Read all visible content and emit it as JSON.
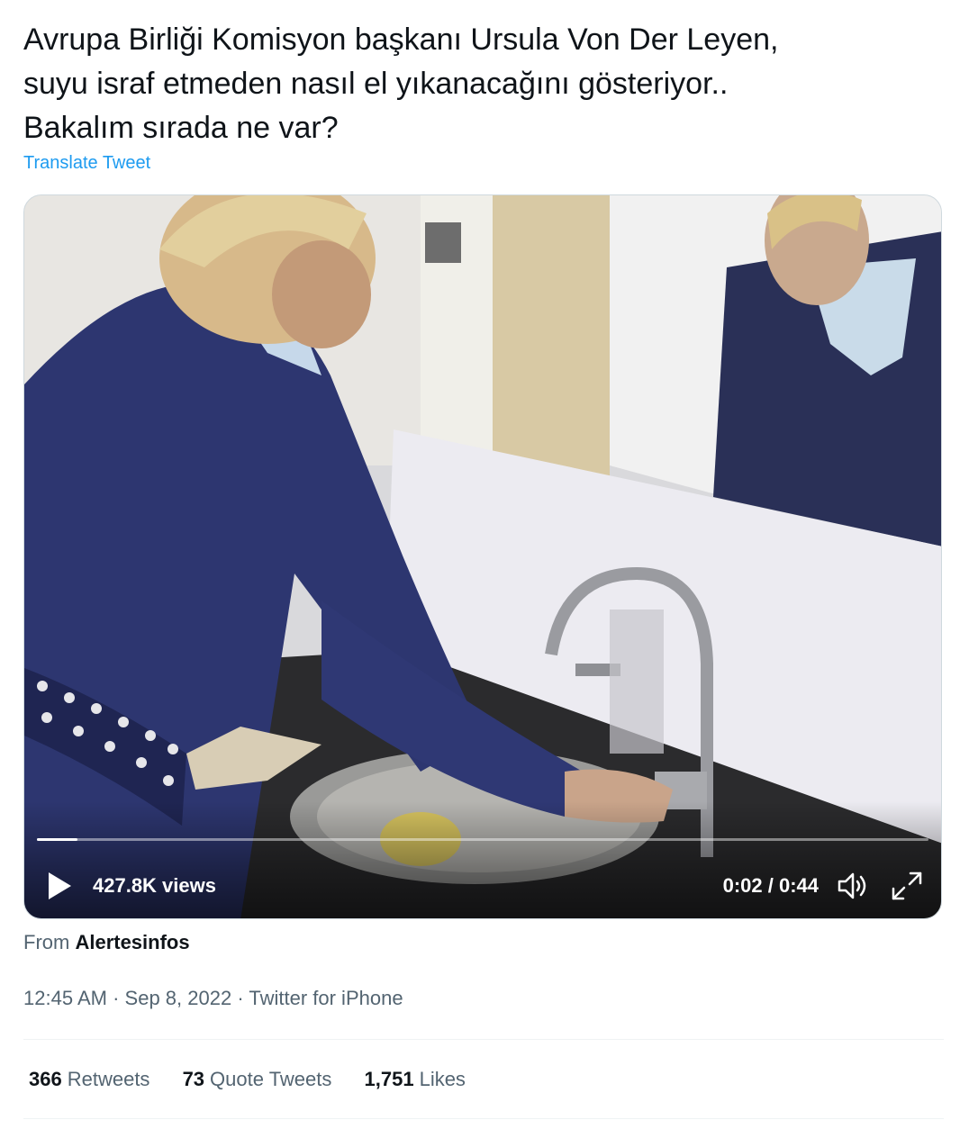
{
  "tweet": {
    "text_lines": [
      "Avrupa Birliği Komisyon başkanı Ursula Von Der Leyen,",
      "suyu israf etmeden nasıl el yıkanacağını gösteriyor..",
      "Bakalım sırada ne var?"
    ],
    "translate_label": "Translate Tweet"
  },
  "video": {
    "views": "427.8K views",
    "timecode": "0:02 / 0:44",
    "progress_fraction": 0.045,
    "icons": {
      "play": "play-icon",
      "volume": "volume-icon",
      "fullscreen": "fullscreen-icon"
    }
  },
  "source": {
    "prefix": "From",
    "account": "Alertesinfos"
  },
  "meta": {
    "time": "12:45 AM",
    "separator": "·",
    "date": "Sep 8, 2022",
    "client": "Twitter for iPhone"
  },
  "stats": [
    {
      "count": "366",
      "label": "Retweets"
    },
    {
      "count": "73",
      "label": "Quote Tweets"
    },
    {
      "count": "1,751",
      "label": "Likes"
    }
  ],
  "colors": {
    "link": "#1d9bf0",
    "text": "#0f1419",
    "secondary": "#536471"
  }
}
